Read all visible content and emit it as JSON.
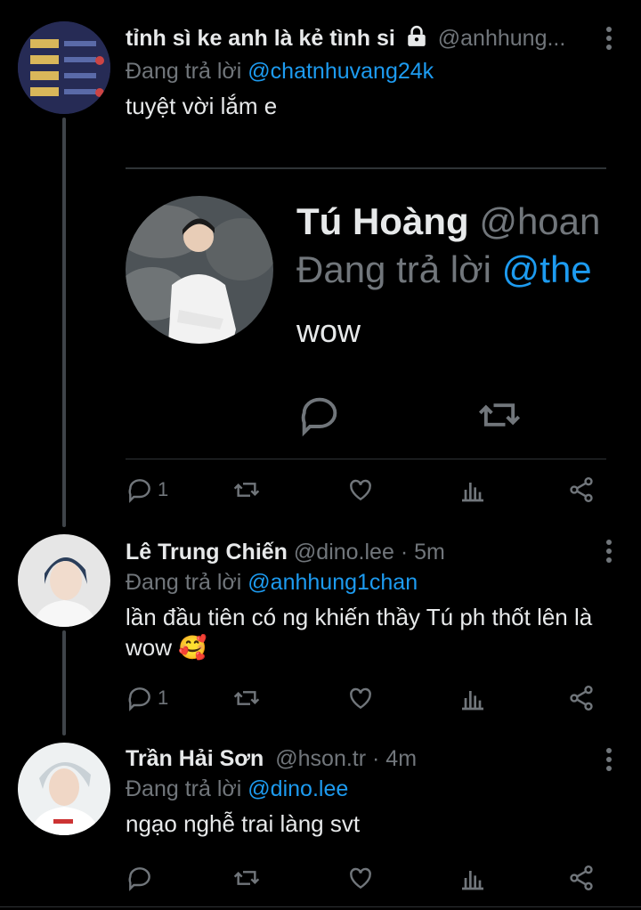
{
  "tweets": [
    {
      "name": "tỉnh sì ke anh là kẻ tình si",
      "handle": "@anhhung...",
      "time": "",
      "reply_prefix": "Đang trả lời",
      "reply_to": "@chatnhuvang24k",
      "text": "tuyệt vời lắm e",
      "replies": "1",
      "locked": true
    },
    {
      "name": "Lê Trung Chiến",
      "handle": "@dino.lee",
      "time": "· 5m",
      "reply_prefix": "Đang trả lời",
      "reply_to": "@anhhung1chan",
      "text": "lần đầu tiên có ng khiến thầy Tú ph thốt lên là wow 🥰",
      "replies": "1"
    },
    {
      "name": "Trần Hải Sơn",
      "handle": "@hson.tr",
      "time": "· 4m",
      "reply_prefix": "Đang trả lời",
      "reply_to": "@dino.lee",
      "text": "ngạo nghễ trai làng svt",
      "replies": ""
    }
  ],
  "quoted": {
    "name": "Tú Hoàng",
    "handle": "@hoan",
    "reply_prefix": "Đang trả lời",
    "reply_to": "@the",
    "text": "wow"
  },
  "icons": [
    "reply-icon",
    "retweet-icon",
    "like-icon",
    "analytics-icon",
    "share-icon",
    "more-icon",
    "lock-icon"
  ],
  "colors": {
    "background": "#000000",
    "text": "#e7e9ea",
    "muted": "#71767b",
    "link": "#1d9bf0"
  }
}
